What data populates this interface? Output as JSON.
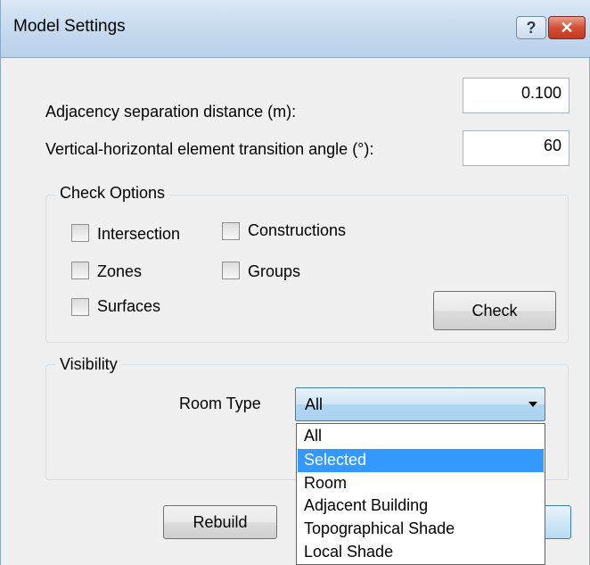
{
  "window": {
    "title": "Model Settings",
    "help_label": "?",
    "close_label": "✕"
  },
  "settings": {
    "adjacency_label": "Adjacency separation distance (m):",
    "adjacency_value": "0.100",
    "transition_label": "Vertical-horizontal element transition angle (°):",
    "transition_value": "60"
  },
  "check_options": {
    "title": "Check Options",
    "intersection": "Intersection",
    "constructions": "Constructions",
    "zones": "Zones",
    "groups": "Groups",
    "surfaces": "Surfaces",
    "check_button": "Check"
  },
  "visibility": {
    "title": "Visibility",
    "room_type_label": "Room Type",
    "room_type_value": "All",
    "options": [
      "All",
      "Selected",
      "Room",
      "Adjacent Building",
      "Topographical Shade",
      "Local Shade"
    ],
    "highlighted_option": "Selected"
  },
  "footer": {
    "rebuild_button": "Rebuild"
  }
}
